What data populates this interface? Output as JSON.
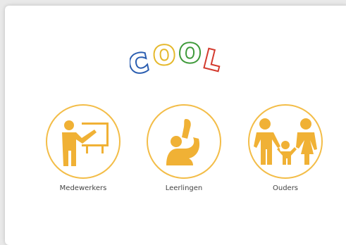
{
  "logo": {
    "text": "COOL"
  },
  "roles": [
    {
      "label": "Medewerkers",
      "icon": "teacher-icon"
    },
    {
      "label": "Leerlingen",
      "icon": "student-raising-hand-icon"
    },
    {
      "label": "Ouders",
      "icon": "parents-with-child-icon"
    }
  ],
  "colors": {
    "accent": "#f3bd48",
    "icon_fill": "#f0b135",
    "logo_blue": "#2a5db0",
    "logo_yellow": "#e5b82b",
    "logo_green": "#3e9a3a",
    "logo_red": "#d33a2e"
  }
}
